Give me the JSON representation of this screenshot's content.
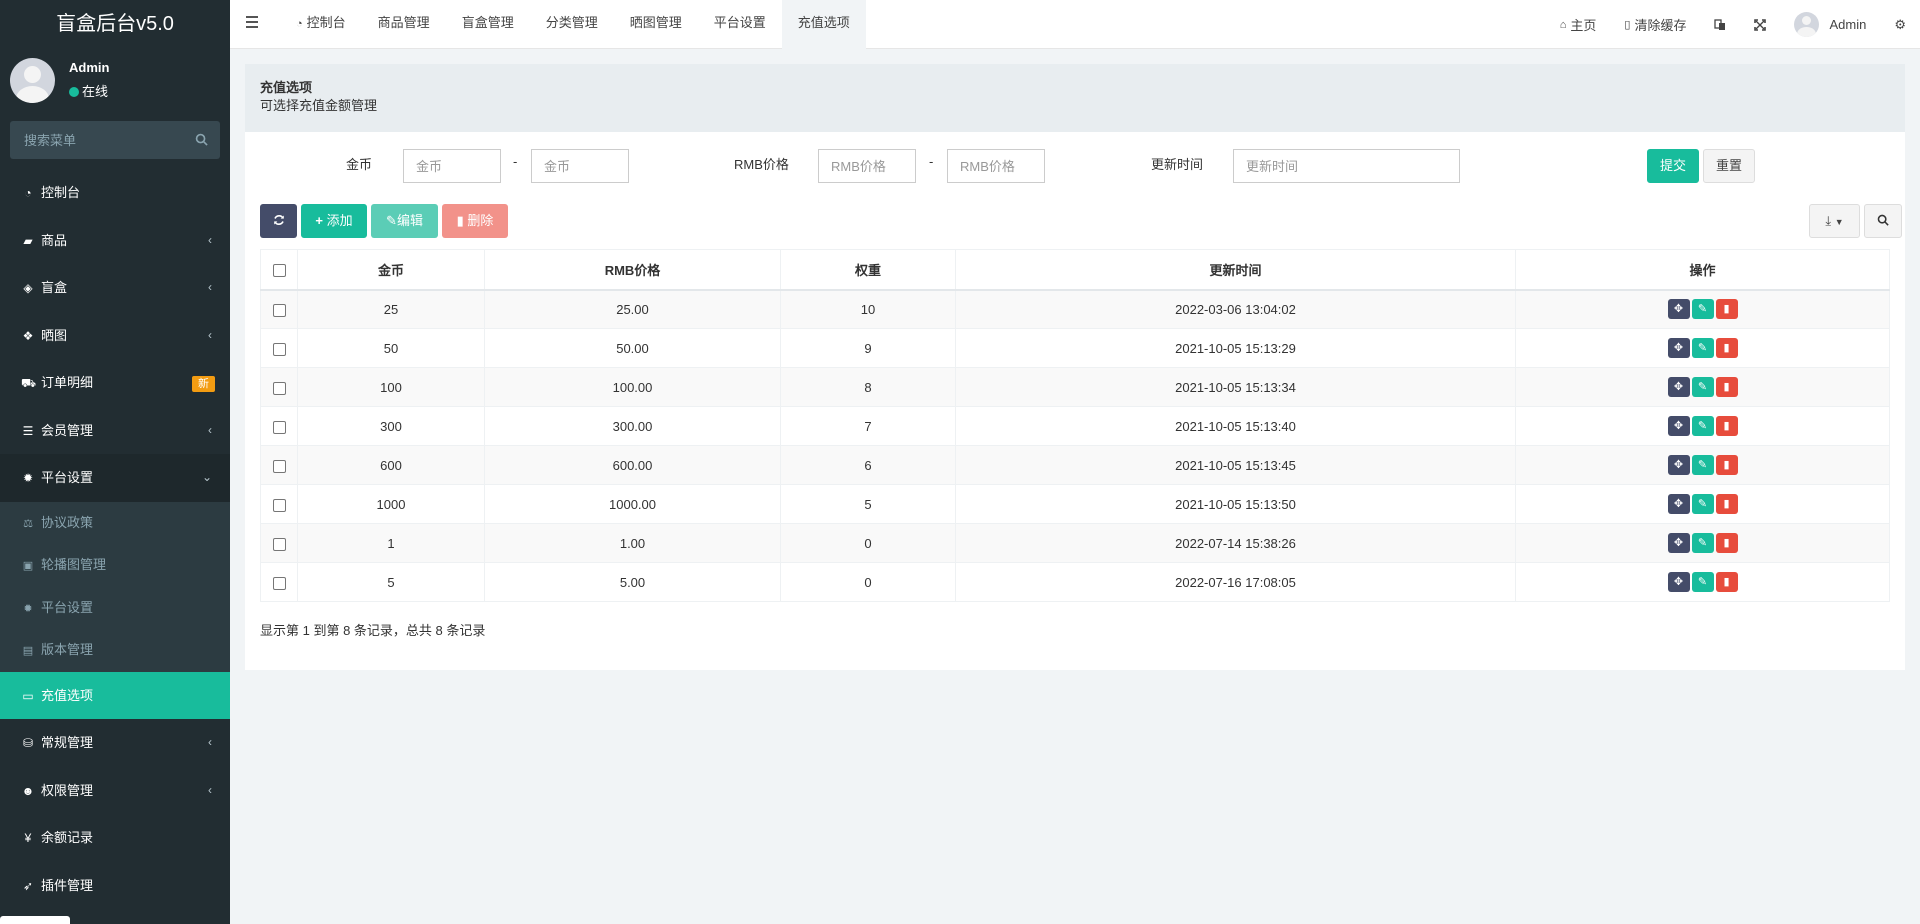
{
  "app": {
    "logo": "盲盒后台v5.0"
  },
  "user": {
    "name": "Admin",
    "status": "在线"
  },
  "sidebar": {
    "search_placeholder": "搜索菜单",
    "items": [
      {
        "label": "控制台",
        "icon": "dashboard-icon"
      },
      {
        "label": "商品",
        "icon": "shopping-bag-icon"
      },
      {
        "label": "盲盒",
        "icon": "cube-icon"
      },
      {
        "label": "晒图",
        "icon": "dropbox-icon"
      },
      {
        "label": "订单明细",
        "icon": "cart-icon",
        "badge": "新"
      },
      {
        "label": "会员管理",
        "icon": "list-icon"
      },
      {
        "label": "平台设置",
        "icon": "gear-icon"
      }
    ],
    "submenu": [
      {
        "label": "协议政策",
        "icon": "balance-scale-icon"
      },
      {
        "label": "轮播图管理",
        "icon": "image-icon"
      },
      {
        "label": "平台设置",
        "icon": "gear-icon"
      },
      {
        "label": "版本管理",
        "icon": "newspaper-icon"
      }
    ],
    "current": {
      "label": "充值选项",
      "icon": "credit-card-icon"
    },
    "items_after": [
      {
        "label": "常规管理",
        "icon": "database-icon"
      },
      {
        "label": "权限管理",
        "icon": "users-icon"
      },
      {
        "label": "余额记录",
        "icon": "yen-icon"
      },
      {
        "label": "插件管理",
        "icon": "rocket-icon"
      }
    ]
  },
  "topnav": {
    "tabs": [
      {
        "label": "控制台",
        "icon": "dashboard-icon"
      },
      {
        "label": "商品管理"
      },
      {
        "label": "盲盒管理"
      },
      {
        "label": "分类管理"
      },
      {
        "label": "晒图管理"
      },
      {
        "label": "平台设置"
      },
      {
        "label": "充值选项",
        "active": true
      }
    ],
    "right": {
      "home": "主页",
      "clear_cache": "清除缓存",
      "admin": "Admin"
    }
  },
  "panel": {
    "title": "充值选项",
    "description": "可选择充值金额管理"
  },
  "filter": {
    "coin_label": "金币",
    "coin_min_placeholder": "金币",
    "coin_max_placeholder": "金币",
    "rmb_label": "RMB价格",
    "rmb_min_placeholder": "RMB价格",
    "rmb_max_placeholder": "RMB价格",
    "time_label": "更新时间",
    "time_placeholder": "更新时间",
    "dash": "-",
    "submit": "提交",
    "reset": "重置"
  },
  "toolbar": {
    "add": "添加",
    "edit": "编辑",
    "delete": "删除"
  },
  "table": {
    "headers": [
      "金币",
      "RMB价格",
      "权重",
      "更新时间",
      "操作"
    ],
    "rows": [
      {
        "coin": "25",
        "rmb": "25.00",
        "weight": "10",
        "updated": "2022-03-06 13:04:02"
      },
      {
        "coin": "50",
        "rmb": "50.00",
        "weight": "9",
        "updated": "2021-10-05 15:13:29"
      },
      {
        "coin": "100",
        "rmb": "100.00",
        "weight": "8",
        "updated": "2021-10-05 15:13:34"
      },
      {
        "coin": "300",
        "rmb": "300.00",
        "weight": "7",
        "updated": "2021-10-05 15:13:40"
      },
      {
        "coin": "600",
        "rmb": "600.00",
        "weight": "6",
        "updated": "2021-10-05 15:13:45"
      },
      {
        "coin": "1000",
        "rmb": "1000.00",
        "weight": "5",
        "updated": "2021-10-05 15:13:50"
      },
      {
        "coin": "1",
        "rmb": "1.00",
        "weight": "0",
        "updated": "2022-07-14 15:38:26"
      },
      {
        "coin": "5",
        "rmb": "5.00",
        "weight": "0",
        "updated": "2022-07-16 17:08:05"
      }
    ]
  },
  "pager": {
    "info": "显示第 1 到第 8 条记录，总共 8 条记录"
  },
  "colors": {
    "sidebar_bg": "#222d32",
    "accent": "#18bc9c",
    "danger": "#e74c3c",
    "dark_btn": "#444c69",
    "badge": "#f39c12"
  }
}
